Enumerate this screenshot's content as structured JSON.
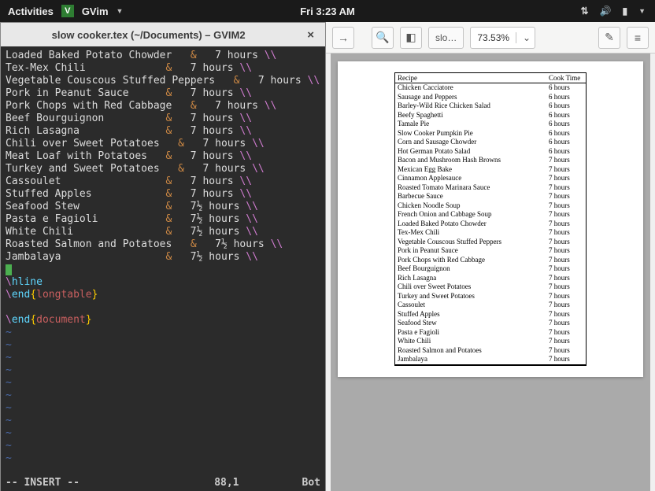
{
  "topbar": {
    "activities": "Activities",
    "app": "GVim",
    "clock": "Fri  3:23 AM"
  },
  "gvim": {
    "title": "slow cooker.tex (~/Documents) – GVIM2",
    "lines": [
      {
        "t": "Loaded Baked Potato Chowder",
        "h": "7 hours"
      },
      {
        "t": "Tex-Mex Chili",
        "h": "7 hours"
      },
      {
        "t": "Vegetable Couscous Stuffed Peppers",
        "h": "7 hours"
      },
      {
        "t": "Pork in Peanut Sauce",
        "h": "7 hours"
      },
      {
        "t": "Pork Chops with Red Cabbage",
        "h": "7 hours"
      },
      {
        "t": "Beef Bourguignon",
        "h": "7 hours"
      },
      {
        "t": "Rich Lasagna",
        "h": "7 hours"
      },
      {
        "t": "Chili over Sweet Potatoes",
        "h": "7 hours"
      },
      {
        "t": "Meat Loaf with Potatoes",
        "h": "7 hours"
      },
      {
        "t": "Turkey and Sweet Potatoes",
        "h": "7 hours"
      },
      {
        "t": "Cassoulet",
        "h": "7 hours"
      },
      {
        "t": "Stuffed Apples",
        "h": "7 hours"
      },
      {
        "t": "Seafood Stew",
        "h": "7½ hours"
      },
      {
        "t": "Pasta e Fagioli",
        "h": "7½ hours"
      },
      {
        "t": "White Chili",
        "h": "7½ hours"
      },
      {
        "t": "Roasted Salmon and Potatoes",
        "h": "7½ hours"
      },
      {
        "t": "Jambalaya",
        "h": "7½ hours"
      }
    ],
    "tail": {
      "hline": "hline",
      "end1": "end",
      "tbl": "longtable",
      "end2": "end",
      "doc": "document"
    },
    "status": {
      "mode": "-- INSERT --",
      "pos": "88,1",
      "where": "Bot"
    }
  },
  "pdfbar": {
    "doc": "slo…",
    "zoom": "73.53%"
  },
  "pdf": {
    "header": {
      "c1": "Recipe",
      "c2": "Cook Time"
    },
    "rows": [
      {
        "r": "Chicken Cacciatore",
        "t": "6 hours"
      },
      {
        "r": "Sausage and Peppers",
        "t": "6 hours"
      },
      {
        "r": "Barley-Wild Rice Chicken Salad",
        "t": "6 hours"
      },
      {
        "r": "Beefy Spaghetti",
        "t": "6 hours"
      },
      {
        "r": "Tamale Pie",
        "t": "6 hours"
      },
      {
        "r": "Slow Cooker Pumpkin Pie",
        "t": "6 hours"
      },
      {
        "r": "Corn and Sausage Chowder",
        "t": "6 hours"
      },
      {
        "r": "Hot German Potato Salad",
        "t": "6 hours"
      },
      {
        "r": "Bacon and Mushroom Hash Browns",
        "t": "7 hours"
      },
      {
        "r": "Mexican Egg Bake",
        "t": "7 hours"
      },
      {
        "r": "Cinnamon Applesauce",
        "t": "7 hours"
      },
      {
        "r": "Roasted Tomato Marinara Sauce",
        "t": "7 hours"
      },
      {
        "r": "Barbecue Sauce",
        "t": "7 hours"
      },
      {
        "r": "Chicken Noodle Soup",
        "t": "7 hours"
      },
      {
        "r": "French Onion and Cabbage Soup",
        "t": "7 hours"
      },
      {
        "r": "Loaded Baked Potato Chowder",
        "t": "7 hours"
      },
      {
        "r": "Tex-Mex Chili",
        "t": "7 hours"
      },
      {
        "r": "Vegetable Couscous Stuffed Peppers",
        "t": "7 hours"
      },
      {
        "r": "Pork in Peanut Sauce",
        "t": "7 hours"
      },
      {
        "r": "Pork Chops with Red Cabbage",
        "t": "7 hours"
      },
      {
        "r": "Beef Bourguignon",
        "t": "7 hours"
      },
      {
        "r": "Rich Lasagna",
        "t": "7 hours"
      },
      {
        "r": "Chili over Sweet Potatoes",
        "t": "7 hours"
      },
      {
        "r": "Turkey and Sweet Potatoes",
        "t": "7 hours"
      },
      {
        "r": "Cassoulet",
        "t": "7 hours"
      },
      {
        "r": "Stuffed Apples",
        "t": "7 hours"
      },
      {
        "r": "Seafood Stew",
        "t": "7 hours"
      },
      {
        "r": "Pasta e Fagioli",
        "t": "7 hours"
      },
      {
        "r": "White Chili",
        "t": "7 hours"
      },
      {
        "r": "Roasted Salmon and Potatoes",
        "t": "7 hours"
      },
      {
        "r": "Jambalaya",
        "t": "7 hours"
      }
    ]
  }
}
